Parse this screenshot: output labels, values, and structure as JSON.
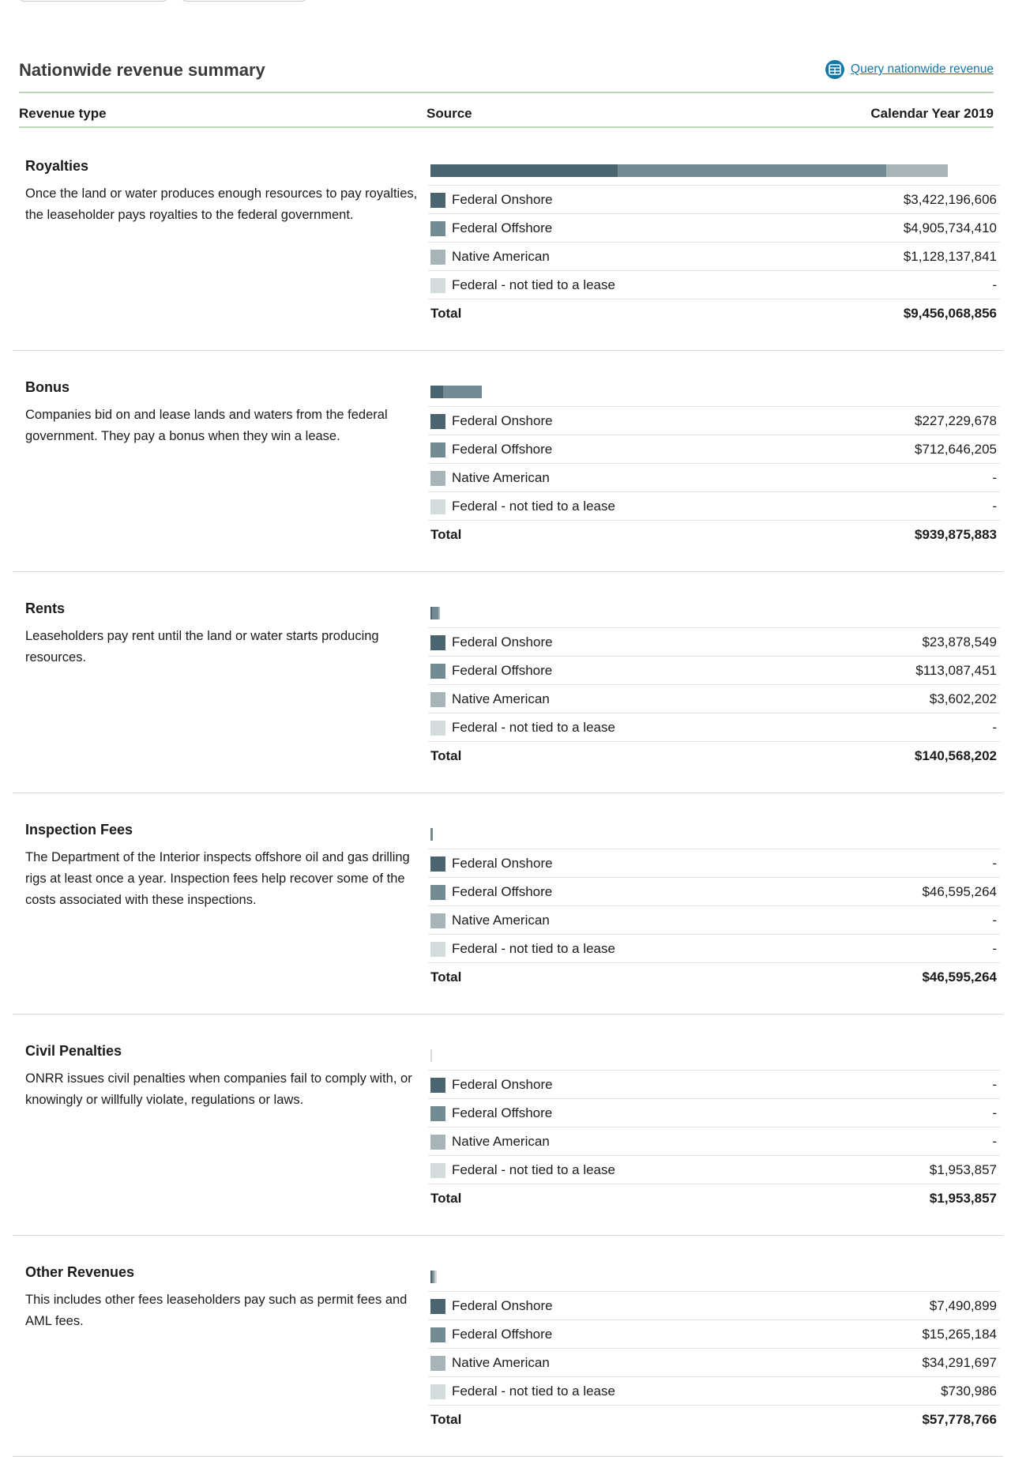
{
  "header": {
    "title": "Nationwide revenue summary",
    "query_label": "Query nationwide revenue"
  },
  "columns": {
    "revenue_type": "Revenue type",
    "source": "Source",
    "period": "Calendar Year 2019"
  },
  "colors": {
    "federal_onshore": "#4a6570",
    "federal_offshore": "#728b93",
    "native_american": "#a7b4b8",
    "federal_not_tied": "#d4dcde",
    "link": "#1478a7",
    "rule": "#bcd8b9"
  },
  "source_labels": [
    "Federal Onshore",
    "Federal Offshore",
    "Native American",
    "Federal - not tied to a lease"
  ],
  "total_label": "Total",
  "sections": [
    {
      "name": "Royalties",
      "description": "Once the land or water produces enough resources to pay royalties, the leaseholder pays royalties to the federal government.",
      "amounts": [
        3422196606,
        4905734410,
        1128137841,
        0
      ],
      "values": [
        "$3,422,196,606",
        "$4,905,734,410",
        "$1,128,137,841",
        "-"
      ],
      "total": "$9,456,068,856"
    },
    {
      "name": "Bonus",
      "description": "Companies bid on and lease lands and waters from the federal government. They pay a bonus when they win a lease.",
      "amounts": [
        227229678,
        712646205,
        0,
        0
      ],
      "values": [
        "$227,229,678",
        "$712,646,205",
        "-",
        "-"
      ],
      "total": "$939,875,883"
    },
    {
      "name": "Rents",
      "description": "Leaseholders pay rent until the land or water starts producing resources.",
      "amounts": [
        23878549,
        113087451,
        3602202,
        0
      ],
      "values": [
        "$23,878,549",
        "$113,087,451",
        "$3,602,202",
        "-"
      ],
      "total": "$140,568,202"
    },
    {
      "name": "Inspection Fees",
      "description": "The Department of the Interior inspects offshore oil and gas drilling rigs at least once a year. Inspection fees help recover some of the costs associated with these inspections.",
      "amounts": [
        0,
        46595264,
        0,
        0
      ],
      "values": [
        "-",
        "$46,595,264",
        "-",
        "-"
      ],
      "total": "$46,595,264"
    },
    {
      "name": "Civil Penalties",
      "description": "ONRR issues civil penalties when companies fail to comply with, or knowingly or willfully violate, regulations or laws.",
      "amounts": [
        0,
        0,
        0,
        1953857
      ],
      "values": [
        "-",
        "-",
        "-",
        "$1,953,857"
      ],
      "total": "$1,953,857"
    },
    {
      "name": "Other Revenues",
      "description": "This includes other fees leaseholders pay such as permit fees and AML fees.",
      "amounts": [
        7490899,
        15265184,
        34291697,
        730986
      ],
      "values": [
        "$7,490,899",
        "$15,265,184",
        "$34,291,697",
        "$730,986"
      ],
      "total": "$57,778,766"
    }
  ]
}
